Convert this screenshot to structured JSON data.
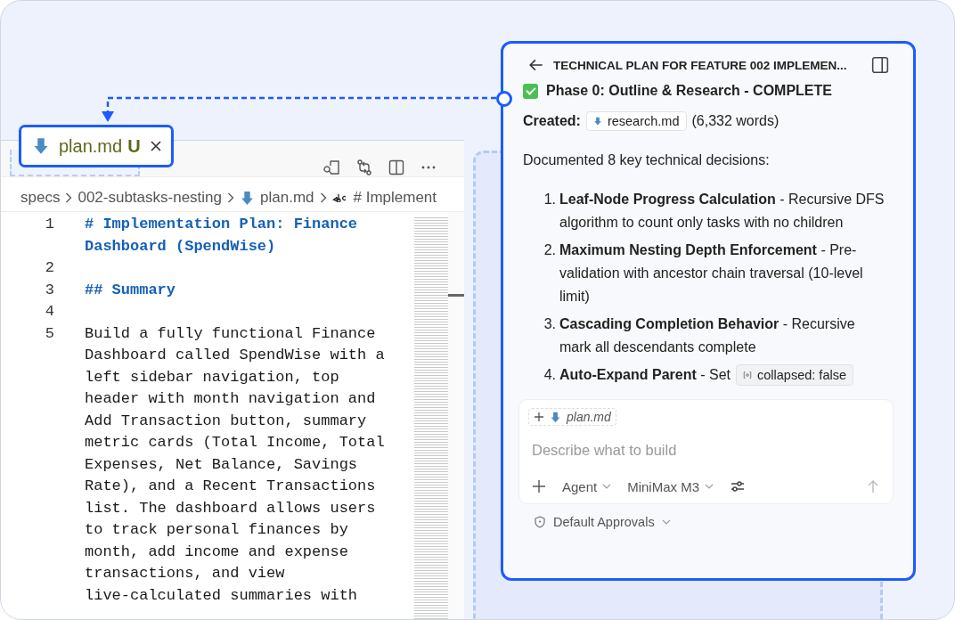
{
  "editor": {
    "tab": {
      "label": "plan.md",
      "status": "U",
      "selected": true
    },
    "breadcrumb": [
      "specs",
      "002-subtasks-nesting",
      "plan.md",
      "# Implement"
    ],
    "code_lines": [
      {
        "number": "1",
        "kind": "heading",
        "rows": [
          "# Implementation Plan: Finance",
          "Dashboard (SpendWise)"
        ]
      },
      {
        "number": "2",
        "kind": "blank"
      },
      {
        "number": "3",
        "kind": "heading",
        "rows": [
          "## Summary"
        ]
      },
      {
        "number": "4",
        "kind": "blank"
      },
      {
        "number": "5",
        "kind": "text",
        "rows": [
          "Build a fully functional Finance",
          "Dashboard called SpendWise with a",
          "left sidebar navigation, top",
          "header with month navigation and",
          "Add Transaction button, summary",
          "metric cards (Total Income, Total",
          "Expenses, Net Balance, Savings",
          "Rate), and a Recent Transactions",
          "list. The dashboard allows users",
          "to track personal finances by",
          "month, add income and expense",
          "transactions, and view",
          "live-calculated summaries with"
        ]
      }
    ]
  },
  "chat": {
    "title": "TECHNICAL PLAN FOR FEATURE 002 IMPLEMEN...",
    "phase": {
      "text": "Phase 0: Outline & Research - COMPLETE",
      "checked": true
    },
    "created_label": "Created:",
    "created_file": "research.md",
    "created_count": "(6,332 words)",
    "intro": "Documented 8 key technical decisions:",
    "decisions": [
      {
        "number": "1.",
        "text": "**Leaf-Node Progress Calculation** - Recursive DFS algorithm to count only tasks with no children"
      },
      {
        "number": "2.",
        "text": "**Maximum Nesting Depth Enforcement** - Pre-validation with ancestor chain traversal (10-level limit)"
      },
      {
        "number": "3.",
        "text": "**Cascading Completion Behavior** - Recursive mark all descendants complete"
      },
      {
        "number": "4.",
        "text": "**Auto-Expand Parent** - Set",
        "code": "collapsed: false"
      }
    ],
    "composer": {
      "attachment": "plan.md",
      "placeholder": "Describe what to build",
      "mode": "Agent",
      "model": "MiniMax M3"
    },
    "approvals": "Default Approvals"
  }
}
